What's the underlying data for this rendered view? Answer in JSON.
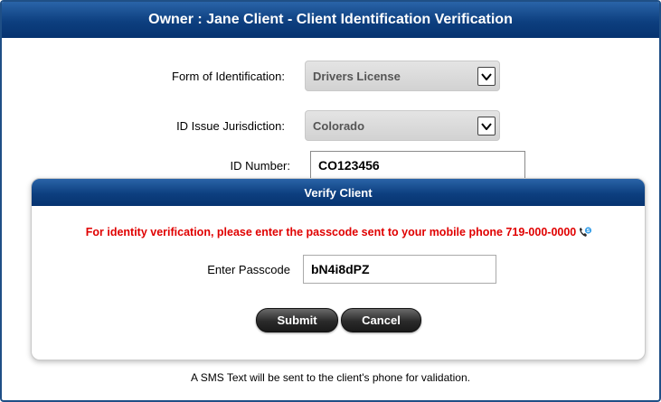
{
  "window": {
    "title": "Owner : Jane Client - Client Identification Verification"
  },
  "form": {
    "id_form_label": "Form of Identification:",
    "id_form_value": "Drivers License",
    "jurisdiction_label": "ID Issue Jurisdiction:",
    "jurisdiction_value": "Colorado",
    "id_number_label": "ID Number:",
    "id_number_value": "CO123456"
  },
  "dialog": {
    "title": "Verify Client",
    "message": "For identity verification, please enter the passcode sent to your mobile phone 719-000-0000",
    "passcode_label": "Enter Passcode",
    "passcode_value": "bN4i8dPZ",
    "submit_label": "Submit",
    "cancel_label": "Cancel",
    "phone_icon": "phone-icon"
  },
  "footer": {
    "note": "A SMS Text will be sent to the client's phone for validation."
  },
  "colors": {
    "header_blue": "#0d3f7f",
    "alert_red": "#e00000",
    "button_dark": "#2a2a2a"
  }
}
